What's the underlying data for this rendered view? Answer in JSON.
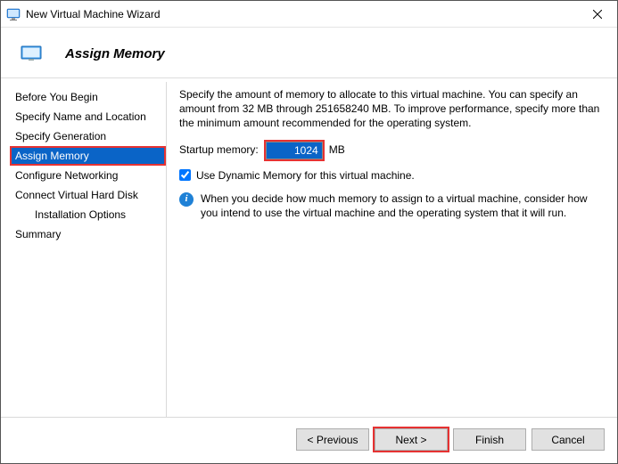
{
  "window": {
    "title": "New Virtual Machine Wizard"
  },
  "header": {
    "title": "Assign Memory"
  },
  "sidebar": {
    "items": [
      {
        "label": "Before You Begin"
      },
      {
        "label": "Specify Name and Location"
      },
      {
        "label": "Specify Generation"
      },
      {
        "label": "Assign Memory"
      },
      {
        "label": "Configure Networking"
      },
      {
        "label": "Connect Virtual Hard Disk"
      },
      {
        "label": "Installation Options"
      },
      {
        "label": "Summary"
      }
    ]
  },
  "content": {
    "description": "Specify the amount of memory to allocate to this virtual machine. You can specify an amount from 32 MB through 251658240 MB. To improve performance, specify more than the minimum amount recommended for the operating system.",
    "memory_label": "Startup memory:",
    "memory_value": "1024",
    "memory_unit": "MB",
    "dynamic_checked": true,
    "dynamic_label": "Use Dynamic Memory for this virtual machine.",
    "info_text": "When you decide how much memory to assign to a virtual machine, consider how you intend to use the virtual machine and the operating system that it will run."
  },
  "buttons": {
    "previous": "< Previous",
    "next": "Next >",
    "finish": "Finish",
    "cancel": "Cancel"
  }
}
